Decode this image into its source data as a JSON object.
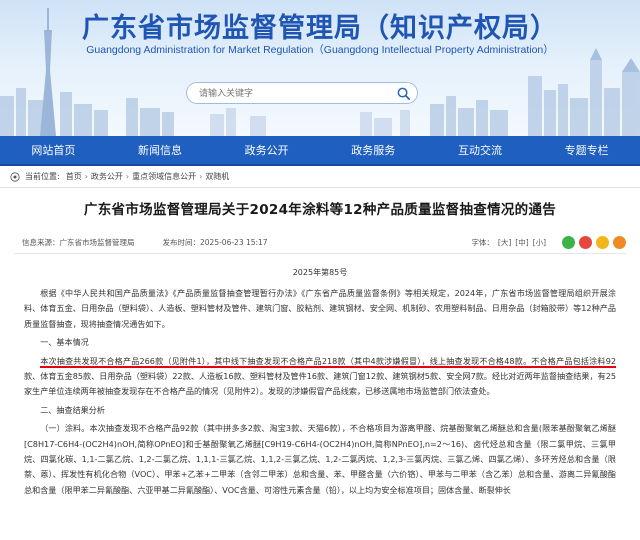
{
  "header": {
    "title": "广东省市场监督管理局（知识产权局）",
    "subtitle": "Guangdong Administration for Market Regulation（Guangdong Intellectual Property Administration）",
    "search": {
      "placeholder": "请输入关键字"
    }
  },
  "nav": {
    "items": [
      {
        "label": "网站首页"
      },
      {
        "label": "新闻信息"
      },
      {
        "label": "政务公开"
      },
      {
        "label": "政务服务"
      },
      {
        "label": "互动交流"
      },
      {
        "label": "专题专栏"
      }
    ]
  },
  "breadcrumb": {
    "label": "当前位置:",
    "items": [
      "首页",
      "政务公开",
      "重点领域信息公开",
      "双随机"
    ]
  },
  "article": {
    "title": "广东省市场监督管理局关于2024年涂料等12种产品质量监督抽查情况的通告",
    "source": "信息来源：广东省市场监督管理局",
    "time": "发布时间：2025-06-23 15:17",
    "font_size_label": "字体：",
    "font_sizes": [
      "[大]",
      "[中]",
      "[小]"
    ],
    "share_icons": [
      "wechat-icon",
      "weibo-icon",
      "qzone-icon",
      "favorite-icon"
    ],
    "doc_no": "2025年第85号",
    "para1": "根据《中华人民共和国产品质量法》《产品质量监督抽查管理暂行办法》《广东省产品质量监督条例》等相关规定，2024年，广东省市场监督管理局组织开展涂料、体育五金、日用杂品（塑料袋）、人造板、塑料管材及管件、建筑门窗、胶粘剂、建筑钢材、安全网、机制砂、农用塑料制品、日用杂品（封箱胶带）等12种产品质量监督抽查，现将抽查情况通告如下。",
    "sec1": "一、基本情况",
    "para2a": "本次抽查共发现不合格产品266款（见附件1），其中线下抽查发现不合格产品218款（其中4款涉嫌假冒），线上抽查发现不合格48款。",
    "para2_highlight": "不合格产品包括涂料92",
    "para2b": "款、体育五金85款、日用杂品（塑料袋）22款、人造板16款、塑料管材及管件16款、建筑门窗12款、建筑钢材5款、安全网7款。经比对近两年监督抽查结果，有25家生产单位连续两年被抽查发现存在不合格产品的情况（见附件2）。发现的涉嫌假冒产品线索，已移送属地市场监管部门依法查处。",
    "sec2": "二、抽查结果分析",
    "para3": "（一）涂料。本次抽查发现不合格产品92款（其中拼多多2款、淘宝3款、天猫6款），不合格项目为游离甲醛、烷基酚聚氧乙烯醚总和含量(限苯基酚聚氧乙烯醚[C8H17-C6H4-(OC2H4)nOH,简称OPnEO]和壬基酚聚氧乙烯醚[C9H19-C6H4-(OC2H4)nOH,简称NPnEO],n=2～16)、卤代烃总和含量（限二氯甲烷、三氯甲烷、四氯化碳、1,1-二氯乙烷、1,2-二氯乙烷、1,1,1-三氯乙烷、1,1,2-三氯乙烷、1,2-二氯丙烷、1,2,3-三氯丙烷、三氯乙烯、四氯乙烯）、多环芳烃总和含量（限萘、蒽）、挥发性有机化合物（VOC）、甲苯+乙苯+二甲苯（含邻二甲苯）总和含量、苯、甲醛含量（六价铬）、甲苯与二甲苯（含乙苯）总和含量、游离二异氰酸酯总和含量（限甲苯二异氰酸酯、六亚甲基二异氰酸酯）、VOC含量、可溶性元素含量（铅），以上均为安全标准项目；固体含量、断裂伸长"
  }
}
